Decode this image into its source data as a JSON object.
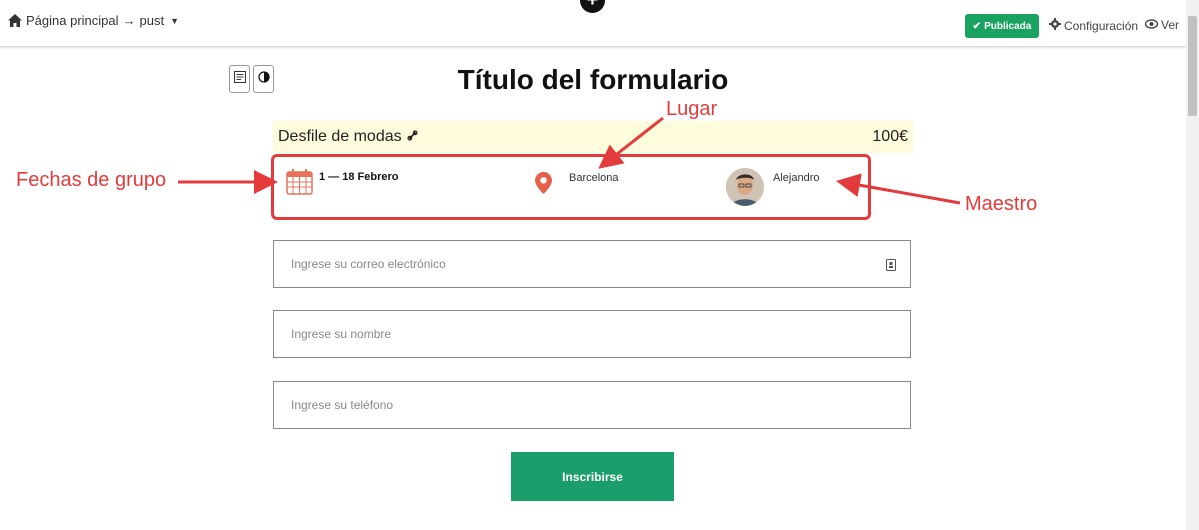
{
  "header": {
    "breadcrumb": {
      "home": "Página principal",
      "arrow": "→",
      "page": "pust"
    },
    "published_label": "Publicada",
    "config_label": "Configuración",
    "view_label": "Ver"
  },
  "form": {
    "title": "Título del formulario",
    "event": {
      "name": "Desfile de modas",
      "price": "100€"
    },
    "info": {
      "dates": "1 — 18 Febrero",
      "place": "Barcelona",
      "teacher": "Alejandro"
    },
    "fields": {
      "email_placeholder": "Ingrese su correo electrónico",
      "name_placeholder": "Ingrese su nombre",
      "phone_placeholder": "Ingrese su teléfono"
    },
    "submit_label": "Inscribirse"
  },
  "annotations": {
    "dates": "Fechas de grupo",
    "place": "Lugar",
    "teacher": "Maestro"
  },
  "colors": {
    "accent": "#1aa260",
    "submit": "#1a9e6b",
    "annotation": "#e33b3b",
    "event_bg": "#fffbdc"
  }
}
